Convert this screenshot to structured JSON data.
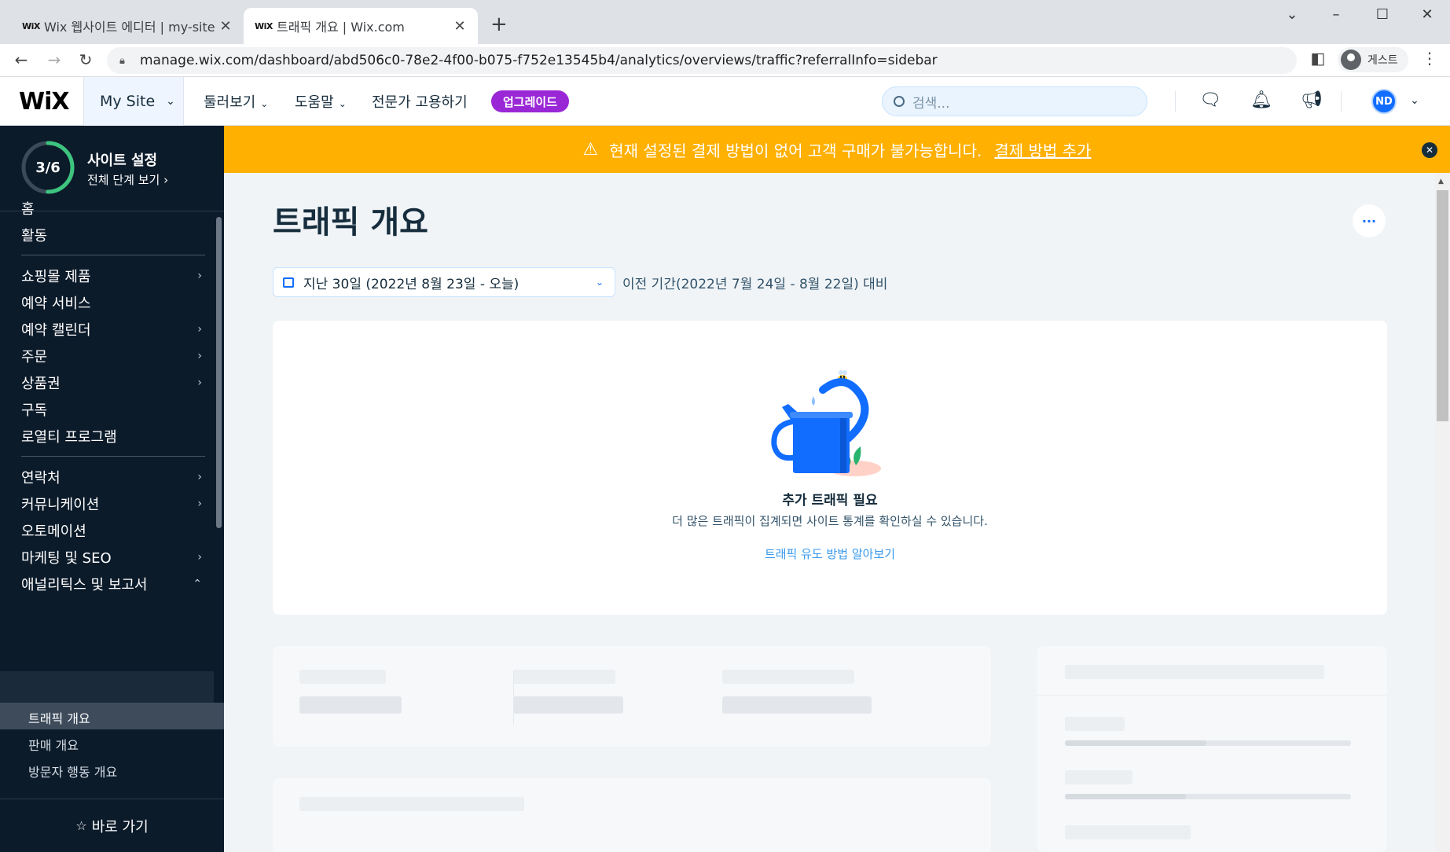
{
  "browser": {
    "tabs": [
      {
        "favicon": "WiX",
        "title": "Wix 웹사이트 에디터 | my-site"
      },
      {
        "favicon": "WiX",
        "title": "트래픽 개요 | Wix.com"
      }
    ],
    "url": "manage.wix.com/dashboard/abd506c0-78e2-4f00-b075-f752e13545b4/analytics/overviews/traffic?referralInfo=sidebar",
    "profile_label": "게스트"
  },
  "topbar": {
    "logo": "WiX",
    "site_selector": "My Site",
    "nav": [
      "둘러보기",
      "도움말",
      "전문가 고용하기"
    ],
    "upgrade_label": "업그레이드",
    "search_placeholder": "검색...",
    "avatar_initials": "ND",
    "accent_color": "#116dff"
  },
  "sidebar": {
    "setup_progress": "3/6",
    "setup_fraction": 0.5,
    "setup_title": "사이트 설정",
    "setup_sub": "전체 단계 보기",
    "items": [
      {
        "label": "홈"
      },
      {
        "label": "활동"
      },
      {
        "label": "쇼핑몰 제품"
      },
      {
        "label": "예약 서비스"
      },
      {
        "label": "예약 캘린더"
      },
      {
        "label": "주문"
      },
      {
        "label": "상품권"
      },
      {
        "label": "구독"
      },
      {
        "label": "로열티 프로그램"
      },
      {
        "label": "연락처"
      },
      {
        "label": "커뮤니케이션"
      },
      {
        "label": "오토메이션"
      },
      {
        "label": "마케팅 및 SEO"
      },
      {
        "label": "애널리틱스 및 보고서"
      }
    ],
    "subitems": [
      "트래픽 개요",
      "판매 개요",
      "방문자 행동 개요"
    ],
    "quick_access": "바로 가기"
  },
  "banner": {
    "message": "현재 설정된 결제 방법이 없어 고객 구매가 불가능합니다.",
    "link": "결제 방법 추가",
    "color": "#ffb000"
  },
  "main": {
    "title": "트래픽 개요",
    "date_range": "지난 30일 (2022년 8월 23일 - 오늘)",
    "compare": "이전 기간(2022년 7월 24일 - 8월 22일) 대비",
    "empty_title": "추가 트래픽 필요",
    "empty_desc": "더 많은 트래픽이 집계되면 사이트 통계를 확인하실 수 있습니다.",
    "empty_link": "트래픽 유도 방법 알아보기"
  }
}
